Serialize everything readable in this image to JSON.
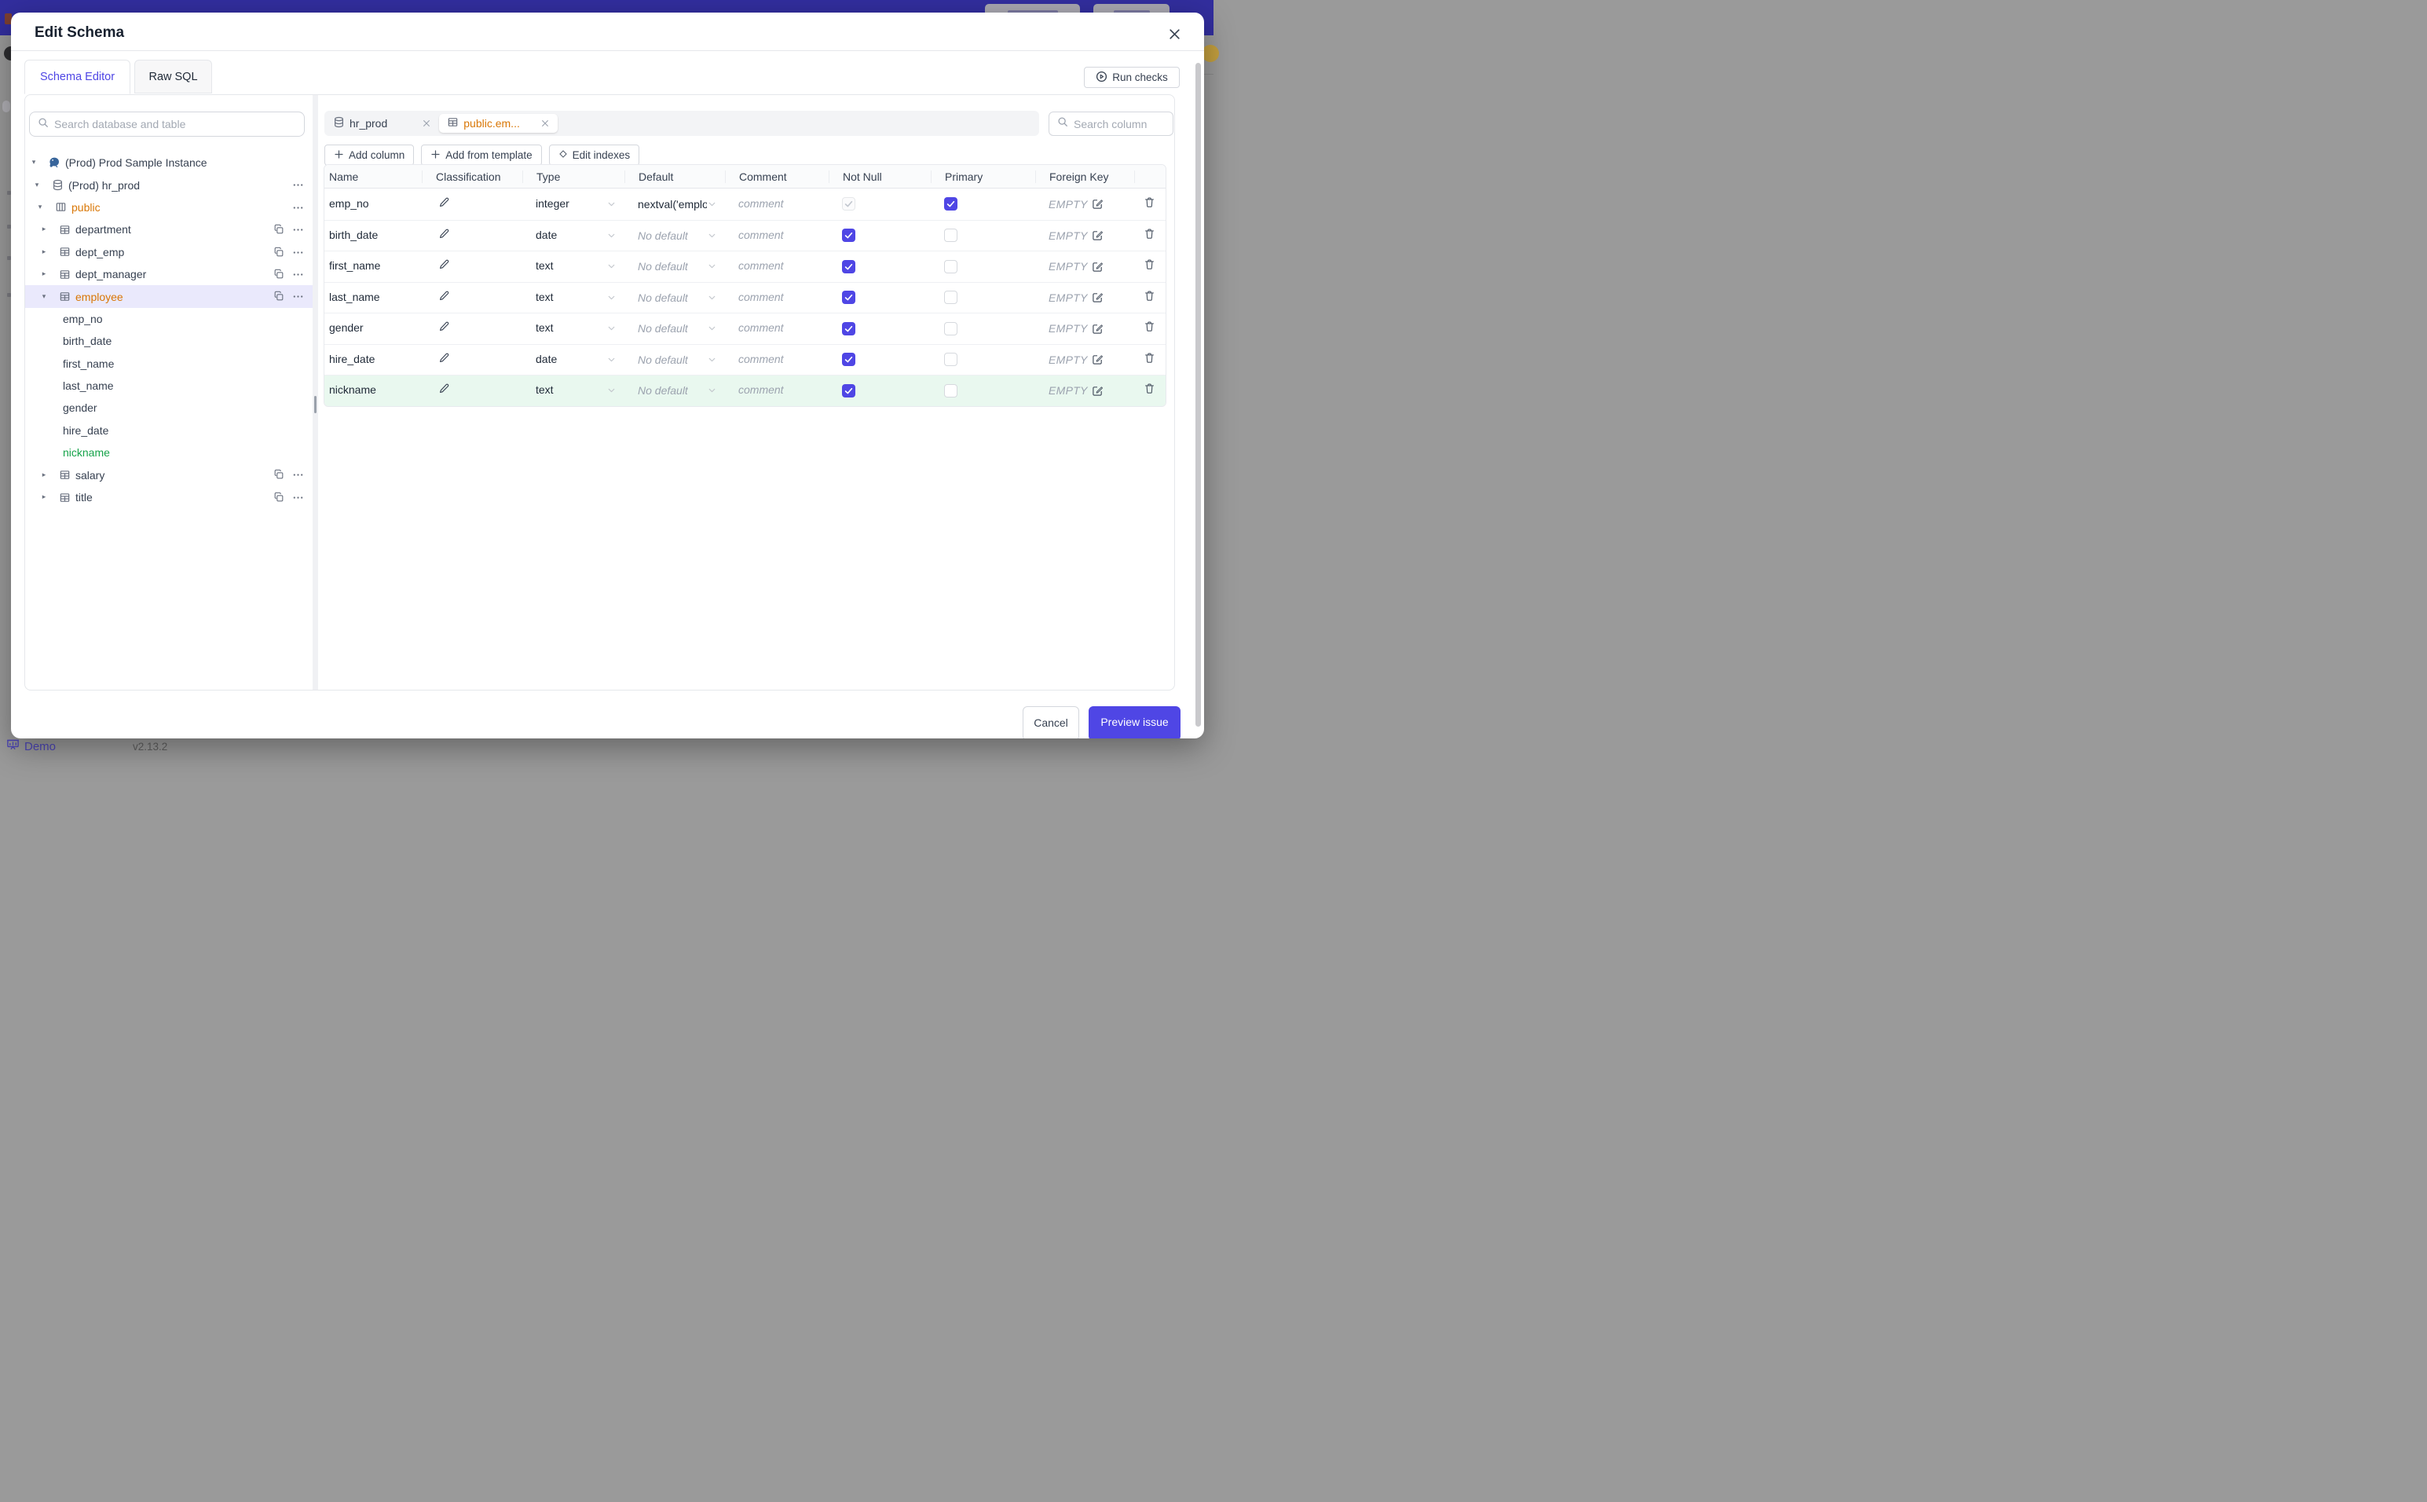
{
  "colors": {
    "accent": "#4f46e5",
    "modified_orange": "#d97706",
    "added_green": "#16a34a",
    "added_row_bg": "#e9f8ef",
    "selected_tree_row_bg": "#eae9fc",
    "topbar": "#322e9e"
  },
  "backdrop": {
    "demo_label": "Demo",
    "version_label": "v2.13.2"
  },
  "modal": {
    "title": "Edit Schema",
    "tabs": [
      {
        "label": "Schema Editor",
        "active": true
      },
      {
        "label": "Raw SQL",
        "active": false
      }
    ],
    "run_checks_label": "Run checks"
  },
  "sidebar": {
    "search_placeholder": "Search database and table",
    "tree": [
      {
        "depth": 0,
        "kind": "instance",
        "label": "(Prod) Prod Sample Instance",
        "expanded": true,
        "selected": false,
        "copy": false,
        "dots": false,
        "color": "default"
      },
      {
        "depth": 1,
        "kind": "database",
        "label": "(Prod) hr_prod",
        "expanded": true,
        "selected": false,
        "copy": false,
        "dots": true,
        "color": "default"
      },
      {
        "depth": 2,
        "kind": "schema",
        "label": "public",
        "expanded": true,
        "selected": false,
        "copy": false,
        "dots": true,
        "color": "orange"
      },
      {
        "depth": 3,
        "kind": "table",
        "label": "department",
        "expanded": false,
        "selected": false,
        "copy": true,
        "dots": true,
        "color": "default"
      },
      {
        "depth": 3,
        "kind": "table",
        "label": "dept_emp",
        "expanded": false,
        "selected": false,
        "copy": true,
        "dots": true,
        "color": "default"
      },
      {
        "depth": 3,
        "kind": "table",
        "label": "dept_manager",
        "expanded": false,
        "selected": false,
        "copy": true,
        "dots": true,
        "color": "default"
      },
      {
        "depth": 3,
        "kind": "table",
        "label": "employee",
        "expanded": true,
        "selected": true,
        "copy": true,
        "dots": true,
        "color": "orange"
      },
      {
        "depth": 4,
        "kind": "column",
        "label": "emp_no",
        "expanded": null,
        "selected": false,
        "copy": false,
        "dots": false,
        "color": "default"
      },
      {
        "depth": 4,
        "kind": "column",
        "label": "birth_date",
        "expanded": null,
        "selected": false,
        "copy": false,
        "dots": false,
        "color": "default"
      },
      {
        "depth": 4,
        "kind": "column",
        "label": "first_name",
        "expanded": null,
        "selected": false,
        "copy": false,
        "dots": false,
        "color": "default"
      },
      {
        "depth": 4,
        "kind": "column",
        "label": "last_name",
        "expanded": null,
        "selected": false,
        "copy": false,
        "dots": false,
        "color": "default"
      },
      {
        "depth": 4,
        "kind": "column",
        "label": "gender",
        "expanded": null,
        "selected": false,
        "copy": false,
        "dots": false,
        "color": "default"
      },
      {
        "depth": 4,
        "kind": "column",
        "label": "hire_date",
        "expanded": null,
        "selected": false,
        "copy": false,
        "dots": false,
        "color": "default"
      },
      {
        "depth": 4,
        "kind": "column",
        "label": "nickname",
        "expanded": null,
        "selected": false,
        "copy": false,
        "dots": false,
        "color": "green"
      },
      {
        "depth": 3,
        "kind": "table",
        "label": "salary",
        "expanded": false,
        "selected": false,
        "copy": true,
        "dots": true,
        "color": "default"
      },
      {
        "depth": 3,
        "kind": "table",
        "label": "title",
        "expanded": false,
        "selected": false,
        "copy": true,
        "dots": true,
        "color": "default"
      }
    ]
  },
  "editor": {
    "open_tabs": [
      {
        "icon": "database",
        "label": "hr_prod",
        "active": false
      },
      {
        "icon": "table",
        "label": "public.em...",
        "active": true
      }
    ],
    "toolbar": [
      {
        "icon": "plus",
        "label": "Add column"
      },
      {
        "icon": "plus",
        "label": "Add from template"
      },
      {
        "icon": "diamond",
        "label": "Edit indexes"
      }
    ],
    "column_search_placeholder": "Search column",
    "table": {
      "headers": [
        "Name",
        "Classification",
        "Type",
        "Default",
        "Comment",
        "Not Null",
        "Primary",
        "Foreign Key",
        ""
      ],
      "comment_placeholder": "comment",
      "foreign_key_empty_label": "EMPTY",
      "rows": [
        {
          "name": "emp_no",
          "type": "integer",
          "default": "nextval('employ",
          "default_is_placeholder": false,
          "not_null": "disabled-checked",
          "primary": "checked",
          "highlight": false
        },
        {
          "name": "birth_date",
          "type": "date",
          "default": "No default",
          "default_is_placeholder": true,
          "not_null": "checked",
          "primary": "unchecked",
          "highlight": false
        },
        {
          "name": "first_name",
          "type": "text",
          "default": "No default",
          "default_is_placeholder": true,
          "not_null": "checked",
          "primary": "unchecked",
          "highlight": false
        },
        {
          "name": "last_name",
          "type": "text",
          "default": "No default",
          "default_is_placeholder": true,
          "not_null": "checked",
          "primary": "unchecked",
          "highlight": false
        },
        {
          "name": "gender",
          "type": "text",
          "default": "No default",
          "default_is_placeholder": true,
          "not_null": "checked",
          "primary": "unchecked",
          "highlight": false
        },
        {
          "name": "hire_date",
          "type": "date",
          "default": "No default",
          "default_is_placeholder": true,
          "not_null": "checked",
          "primary": "unchecked",
          "highlight": false
        },
        {
          "name": "nickname",
          "type": "text",
          "default": "No default",
          "default_is_placeholder": true,
          "not_null": "checked",
          "primary": "unchecked",
          "highlight": true
        }
      ]
    }
  },
  "footer": {
    "cancel_label": "Cancel",
    "submit_label": "Preview issue"
  }
}
